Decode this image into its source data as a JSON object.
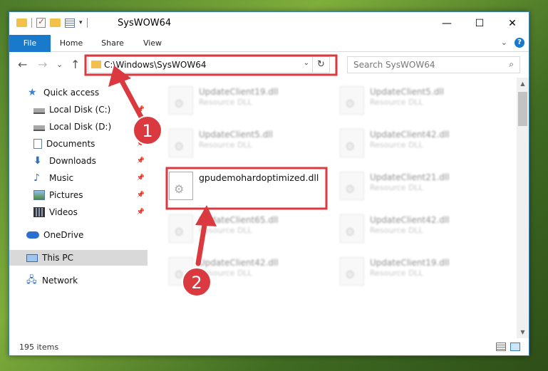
{
  "window": {
    "title": "SysWOW64",
    "controls": {
      "minimize": "—",
      "maximize": "☐",
      "close": "✕"
    }
  },
  "ribbon": {
    "tabs": [
      "File",
      "Home",
      "Share",
      "View"
    ],
    "collapse_glyph": "⌄",
    "help_glyph": "?"
  },
  "nav": {
    "back_glyph": "←",
    "forward_glyph": "→",
    "recent_glyph": "⌄",
    "up_glyph": "↑",
    "address": "C:\\Windows\\SysWOW64",
    "refresh_glyph": "↻",
    "dropdown_glyph": "⌄",
    "search_placeholder": "Search SysWOW64",
    "search_glyph": "⌕"
  },
  "sidebar": {
    "items": [
      {
        "label": "Quick access",
        "icon": "star-icon"
      },
      {
        "label": "Local Disk (C:)",
        "icon": "disk-icon",
        "pinned": true
      },
      {
        "label": "Local Disk (D:)",
        "icon": "disk-icon",
        "pinned": true
      },
      {
        "label": "Documents",
        "icon": "documents-icon",
        "pinned": true
      },
      {
        "label": "Downloads",
        "icon": "download-icon",
        "pinned": true
      },
      {
        "label": "Music",
        "icon": "music-icon",
        "pinned": true
      },
      {
        "label": "Pictures",
        "icon": "pictures-icon",
        "pinned": true
      },
      {
        "label": "Videos",
        "icon": "videos-icon",
        "pinned": true
      },
      {
        "label": "OneDrive",
        "icon": "cloud-icon"
      },
      {
        "label": "This PC",
        "icon": "computer-icon",
        "selected": true
      },
      {
        "label": "Network",
        "icon": "network-icon"
      }
    ],
    "pin_glyph": "📌"
  },
  "files": [
    {
      "name": "UpdateClient19.dll",
      "type": "Resource DLL",
      "blurred": true
    },
    {
      "name": "UpdateClient5.dll",
      "type": "Resource DLL",
      "blurred": true
    },
    {
      "name": "UpdateClient5.dll",
      "type": "Resource DLL",
      "blurred": true
    },
    {
      "name": "UpdateClient42.dll",
      "type": "Resource DLL",
      "blurred": true
    },
    {
      "name": "gpudemohardoptimized.dll",
      "type": "",
      "blurred": false,
      "highlighted": true
    },
    {
      "name": "UpdateClient21.dll",
      "type": "Resource DLL",
      "blurred": true
    },
    {
      "name": "UpdateClient65.dll",
      "type": "Resource DLL",
      "blurred": true
    },
    {
      "name": "UpdateClient42.dll",
      "type": "Resource DLL",
      "blurred": true
    },
    {
      "name": "UpdateClient42.dll",
      "type": "Resource DLL",
      "blurred": true
    },
    {
      "name": "UpdateClient19.dll",
      "type": "Resource DLL",
      "blurred": true
    }
  ],
  "status": {
    "item_count": "195 items"
  },
  "annotations": {
    "step1": "1",
    "step2": "2",
    "color": "#d9393f"
  }
}
